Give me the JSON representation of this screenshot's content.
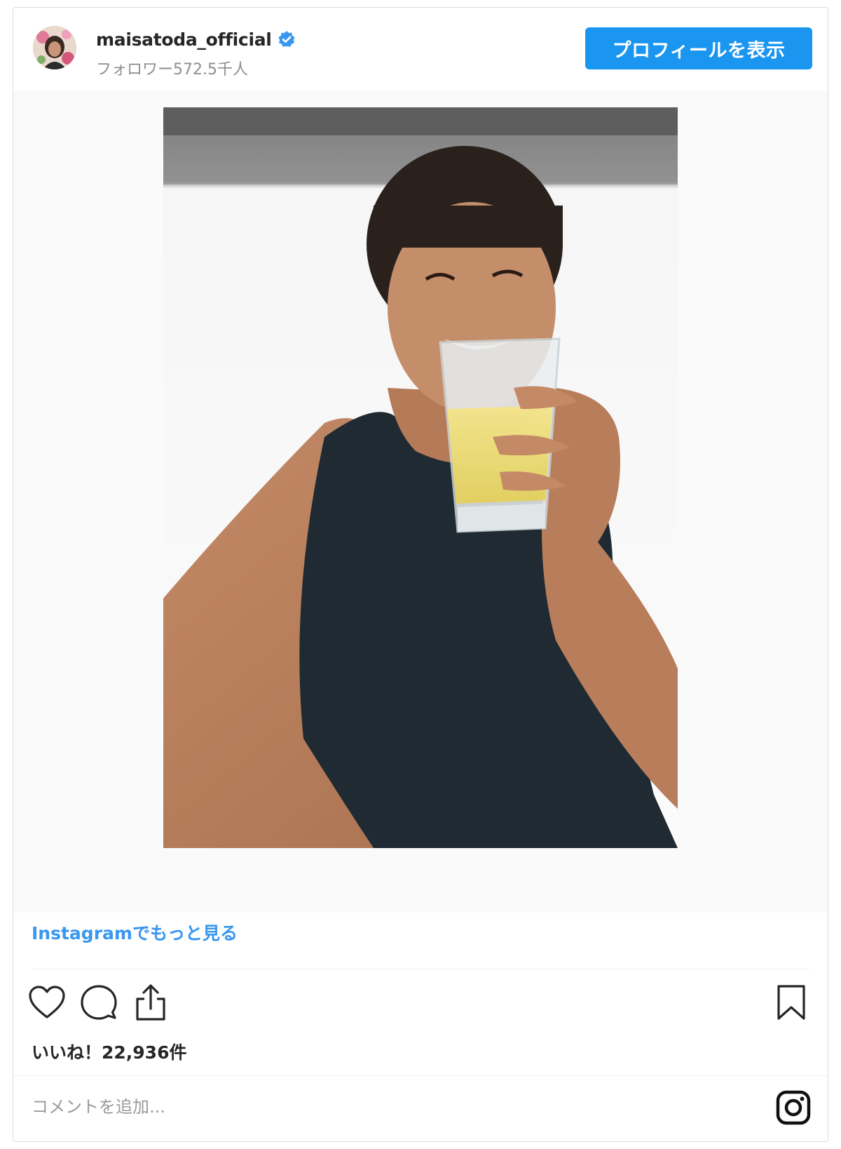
{
  "header": {
    "username": "maisatoda_official",
    "verified": true,
    "followers": "フォロワー572.5千人",
    "profile_button": "プロフィールを表示"
  },
  "post": {
    "image_alt": "",
    "more_link": "Instagramでもっと見る",
    "likes": "いいね！22,936件"
  },
  "actions": {
    "icons": [
      "heart-icon",
      "comment-icon",
      "share-icon",
      "bookmark-icon"
    ]
  },
  "comment": {
    "placeholder": "コメントを追加..."
  },
  "colors": {
    "accent": "#1a95f0",
    "link": "#3897f0",
    "verified": "#3897f0",
    "text": "#262626",
    "muted": "#8e8e8e"
  }
}
